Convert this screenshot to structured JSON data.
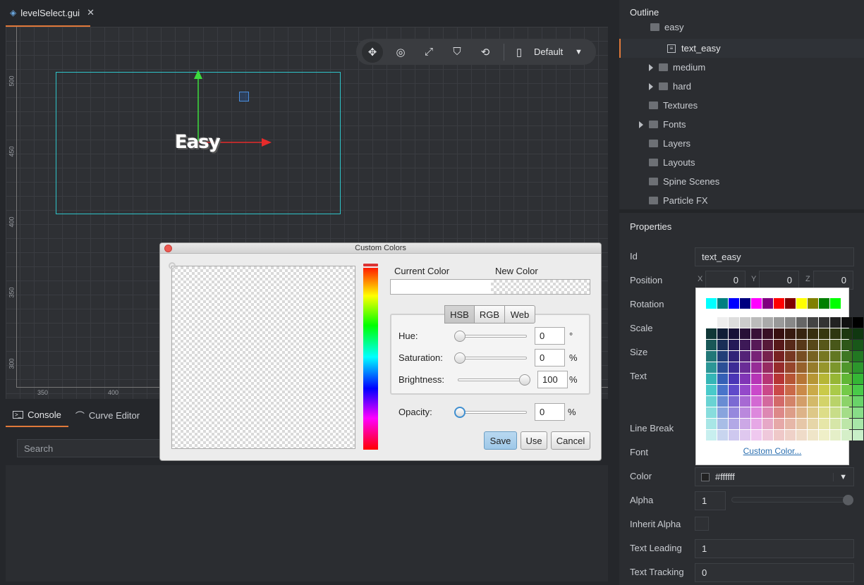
{
  "editor_tab": {
    "filename": "levelSelect.gui",
    "close": "✕"
  },
  "toolbar": {
    "layout_label": "Default"
  },
  "rulers": {
    "vertical": [
      "500",
      "450",
      "400",
      "350",
      "300"
    ],
    "horizontal": [
      "350",
      "400"
    ]
  },
  "scene": {
    "node_text": "Easy"
  },
  "bottom_tabs": [
    {
      "label": "Console"
    },
    {
      "label": "Curve Editor"
    }
  ],
  "console": {
    "search_placeholder": "Search"
  },
  "outline": {
    "title": "Outline",
    "items": [
      {
        "label": "easy"
      },
      {
        "label": "text_easy"
      },
      {
        "label": "medium"
      },
      {
        "label": "hard"
      },
      {
        "label": "Textures"
      },
      {
        "label": "Fonts"
      },
      {
        "label": "Layers"
      },
      {
        "label": "Layouts"
      },
      {
        "label": "Spine Scenes"
      },
      {
        "label": "Particle FX"
      }
    ]
  },
  "properties": {
    "title": "Properties",
    "id": {
      "label": "Id",
      "value": "text_easy"
    },
    "position": {
      "label": "Position",
      "x_label": "X",
      "y_label": "Y",
      "z_label": "Z",
      "x": "0",
      "y": "0",
      "z": "0"
    },
    "rotation": {
      "label": "Rotation"
    },
    "scale": {
      "label": "Scale"
    },
    "size": {
      "label": "Size"
    },
    "text": {
      "label": "Text"
    },
    "line_break": {
      "label": "Line Break"
    },
    "font": {
      "label": "Font"
    },
    "color": {
      "label": "Color",
      "value": "#ffffff"
    },
    "alpha": {
      "label": "Alpha",
      "value": "1"
    },
    "inherit_alpha": {
      "label": "Inherit Alpha"
    },
    "text_leading": {
      "label": "Text Leading",
      "value": "1"
    },
    "text_tracking": {
      "label": "Text Tracking",
      "value": "0"
    }
  },
  "palette": {
    "custom_color_link": "Custom Color..."
  },
  "dialog": {
    "title": "Custom Colors",
    "current_color_label": "Current Color",
    "new_color_label": "New Color",
    "modes": [
      "HSB",
      "RGB",
      "Web"
    ],
    "hue": {
      "label": "Hue:",
      "value": "0",
      "unit": "°",
      "level": 0
    },
    "saturation": {
      "label": "Saturation:",
      "value": "0",
      "unit": "%",
      "level": 0
    },
    "brightness": {
      "label": "Brightness:",
      "value": "100",
      "unit": "%",
      "level": 1
    },
    "opacity": {
      "label": "Opacity:",
      "value": "0",
      "unit": "%",
      "level": 0
    },
    "buttons": {
      "save": "Save",
      "use": "Use",
      "cancel": "Cancel"
    }
  },
  "colors": {
    "accent": "#e0793a",
    "selection_box": "#2ec4c9",
    "gizmo_y": "#3ddc3d",
    "gizmo_x": "#e62b2b",
    "dialog_close": "#ee5a52"
  }
}
